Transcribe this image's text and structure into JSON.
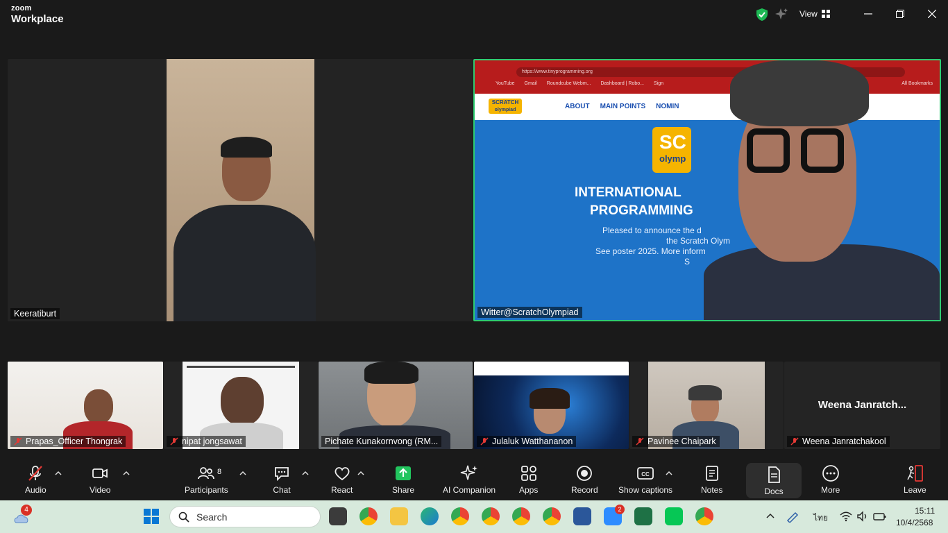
{
  "app": {
    "brand_line1": "zoom",
    "brand_line2": "Workplace",
    "view_label": "View"
  },
  "main_tiles": [
    {
      "name": "Keeratiburt"
    },
    {
      "name": "Witter@ScratchOlympiad"
    }
  ],
  "shared_screen": {
    "url": "https://www.tinyprogramming.org",
    "bookmarks": [
      "YouTube",
      "Gmail",
      "Roundcube Webm...",
      "Dashboard | Robo...",
      "Sign"
    ],
    "bookmarks_right": "All Bookmarks",
    "logo_top": "SCRATCH",
    "logo_bottom": "olympiad",
    "nav": [
      "ABOUT",
      "MAIN POINTS",
      "NOMIN"
    ],
    "big_logo_partial": "SC",
    "big_logo_sub": "olymp",
    "headline1": "INTERNATIONAL",
    "headline2": "PROGRAMMING",
    "body1": "Pleased to announce the d",
    "body2": "the Scratch Olym",
    "body3": "See poster 2025. More inform",
    "body4": "S"
  },
  "gallery": [
    {
      "name": "Prapas_Officer Thongrak",
      "muted": true
    },
    {
      "name": "nipat jongsawat",
      "muted": true
    },
    {
      "name": "Pichate Kunakornvong (RM...",
      "muted": false
    },
    {
      "name": "Julaluk Watthananon",
      "muted": true
    },
    {
      "name": "Pavinee Chaipark",
      "muted": true
    },
    {
      "name": "Weena Janratchakool",
      "muted": true,
      "center_name": "Weena Janratch..."
    }
  ],
  "toolbar": {
    "audio": "Audio",
    "video": "Video",
    "participants": "Participants",
    "participants_count": "8",
    "chat": "Chat",
    "react": "React",
    "share": "Share",
    "ai": "AI Companion",
    "apps": "Apps",
    "record": "Record",
    "captions": "Show captions",
    "notes": "Notes",
    "docs": "Docs",
    "more": "More",
    "leave": "Leave"
  },
  "taskbar": {
    "weather_badge": "4",
    "search_placeholder": "Search",
    "zoom_badge": "2",
    "lang": "ไทย",
    "time": "15:11",
    "date": "10/4/2568"
  },
  "colors": {
    "active_speaker": "#2ecc71",
    "accent_green": "#00c853",
    "leave_red": "#e53935",
    "taskbar_bg": "#d7e9dc"
  }
}
